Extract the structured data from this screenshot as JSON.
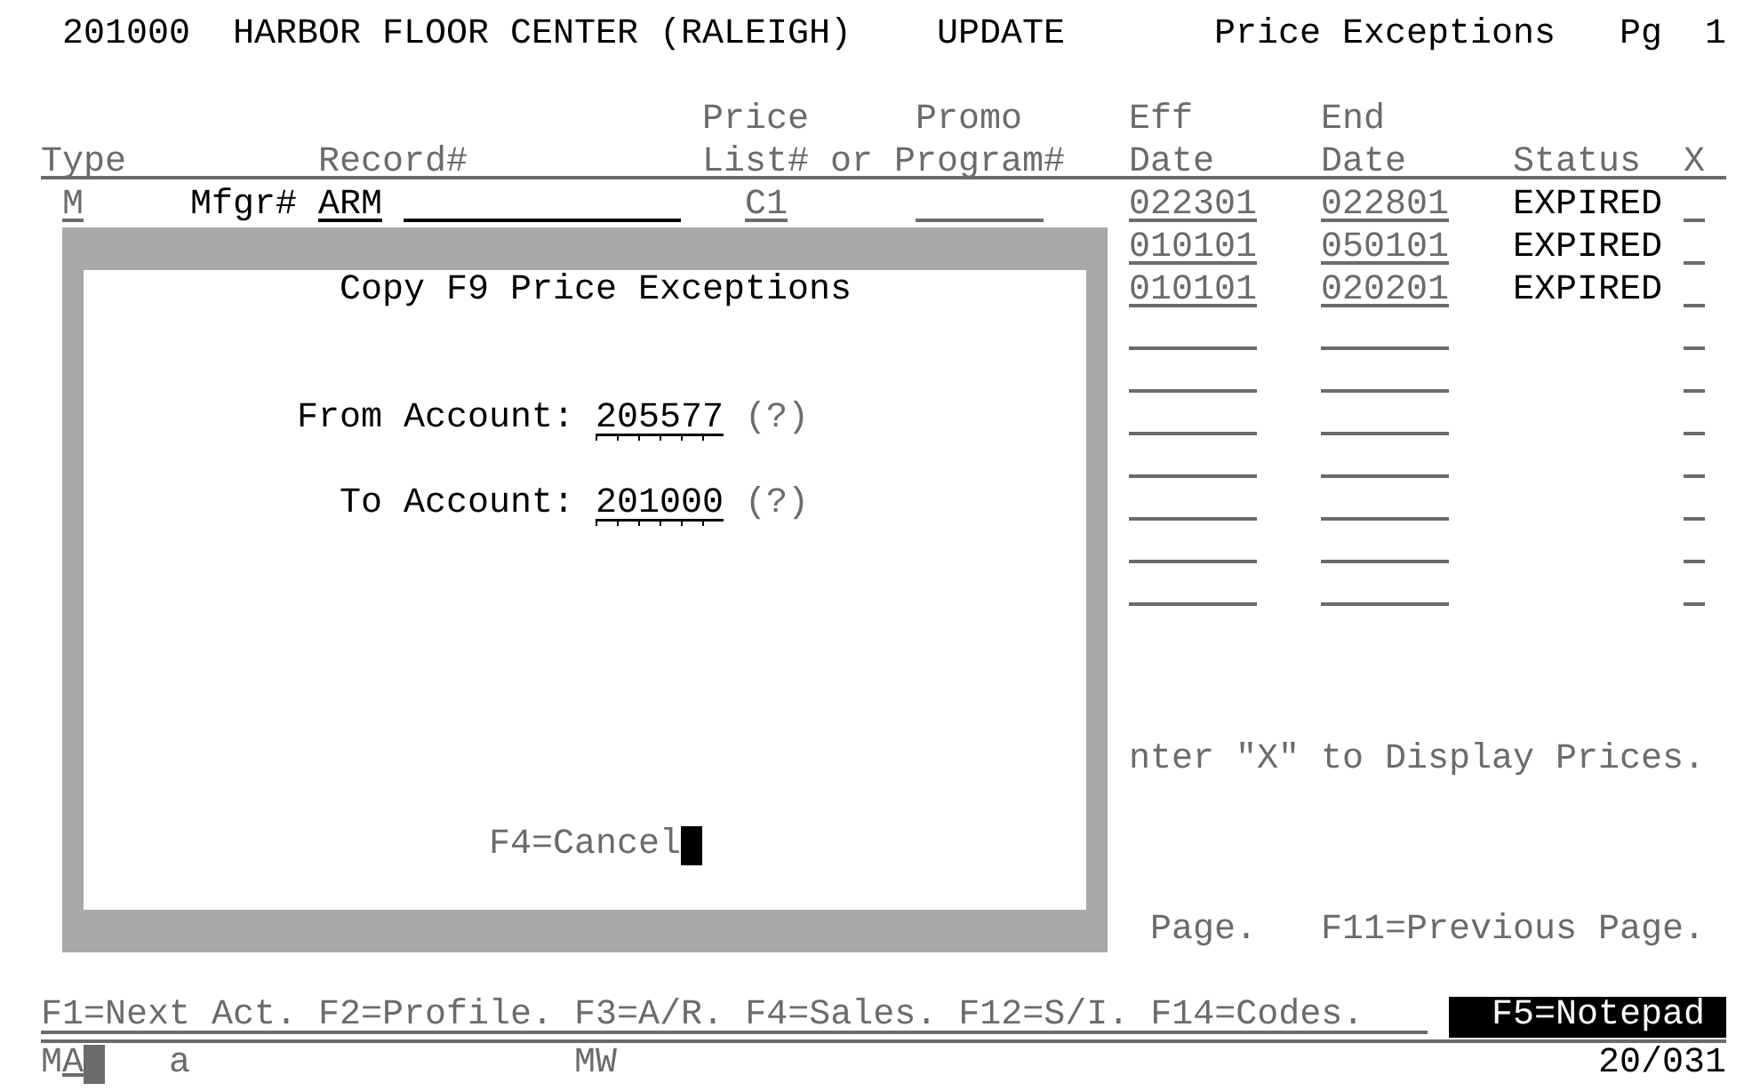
{
  "header": {
    "account": "201000",
    "customer": "HARBOR FLOOR CENTER (RALEIGH)",
    "mode": "UPDATE",
    "title": "Price Exceptions",
    "page_label": "Pg",
    "page": "1"
  },
  "table": {
    "columns": [
      {
        "label": "Type"
      },
      {
        "label": "Record#"
      },
      {
        "label_top": "Price",
        "label": "List# or"
      },
      {
        "label_top": "Promo",
        "label": "Program#"
      },
      {
        "label_top": "Eff",
        "label": "Date"
      },
      {
        "label_top": "End",
        "label": "Date"
      },
      {
        "label": "Status"
      },
      {
        "label": "X"
      }
    ],
    "rows": [
      {
        "kind": "entry",
        "type": "M",
        "record_label": "Mfgr#",
        "record": "ARM",
        "price_list": "C1",
        "eff_date": "022301",
        "end_date": "022801",
        "status": "EXPIRED"
      },
      {
        "kind": "entry",
        "eff_date": "010101",
        "end_date": "050101",
        "status": "EXPIRED"
      },
      {
        "kind": "entry",
        "eff_date": "010101",
        "end_date": "020201",
        "status": "EXPIRED"
      },
      {
        "kind": "blank"
      },
      {
        "kind": "blank"
      },
      {
        "kind": "blank"
      },
      {
        "kind": "blank"
      },
      {
        "kind": "blank"
      },
      {
        "kind": "blank"
      },
      {
        "kind": "blank"
      }
    ]
  },
  "dialog": {
    "title": "Copy F9 Price Exceptions",
    "fields": [
      {
        "label": "From Account:",
        "value": "205577",
        "prompt": "(?)"
      },
      {
        "label": "To Account:",
        "value": "201000",
        "prompt": "(?)"
      }
    ],
    "footer": "F4=Cancel"
  },
  "instruction": "nter \"X\" to Display Prices.",
  "function_hints": [
    "Page.",
    "F11=Previous Page."
  ],
  "function_keys": "F1=Next Act. F2=Profile. F3=A/R. F4=Sales. F12=S/I. F14=Codes.",
  "notepad_key": "F5=Notepad",
  "status_line": {
    "mode": "MA",
    "flag": "a",
    "code": "MW",
    "cursor_position": "20/031"
  }
}
